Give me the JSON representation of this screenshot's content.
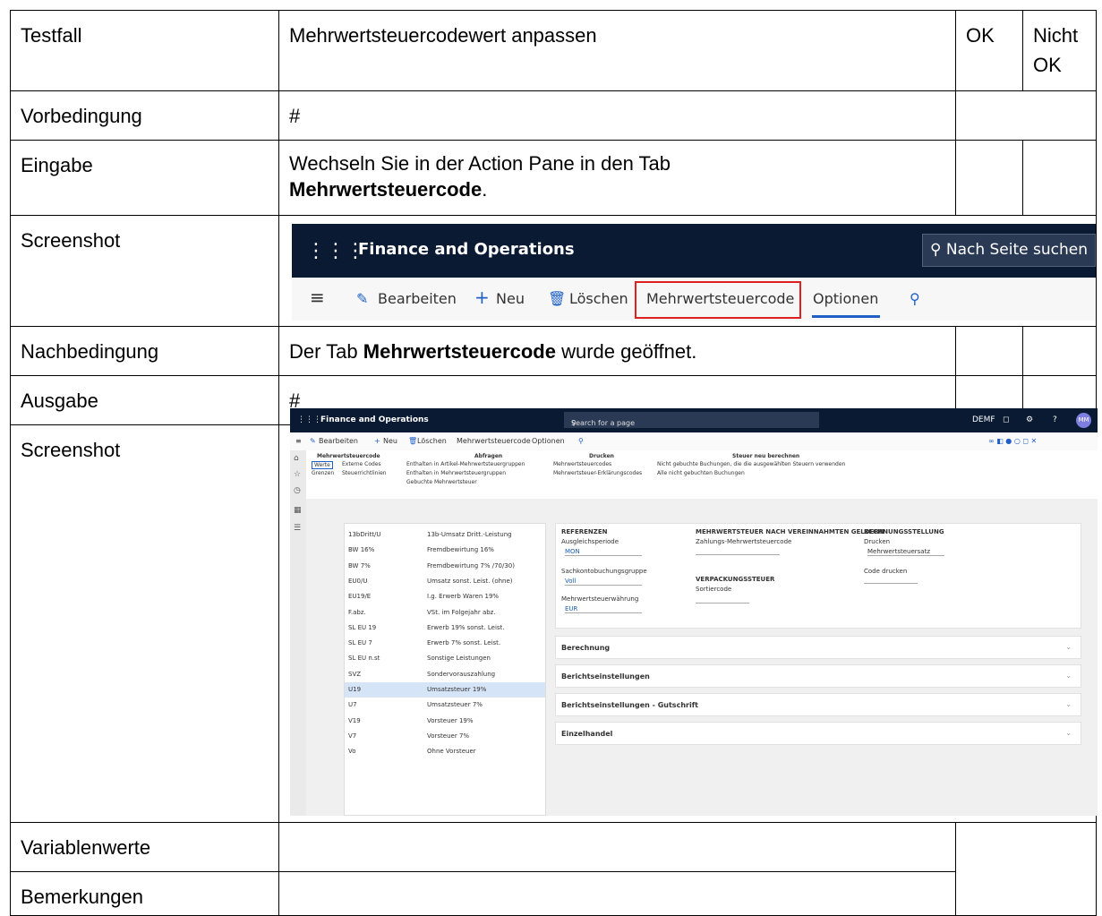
{
  "table": {
    "testfall_label": "Testfall",
    "testfall_value": "Mehrwertsteuercodewert anpassen",
    "ok_label": "OK",
    "nicht_ok_label": "Nicht OK",
    "vorbedingung_label": "Vorbedingung",
    "vorbedingung_value": "#",
    "eingabe_label": "Eingabe",
    "eingabe_text_1": "Wechseln Sie in der Action Pane in den Tab",
    "eingabe_text_bold": "Mehrwertsteuercode",
    "eingabe_text_end": ".",
    "screenshot_label": "Screenshot",
    "nachbedingung_label": "Nachbedingung",
    "nachbedingung_text_1": "Der Tab",
    "nachbedingung_text_bold": "Mehrwertsteuercode",
    "nachbedingung_text_2": "wurde geöffnet.",
    "ausgabe_label": "Ausgabe",
    "ausgabe_value": "#",
    "variablenwerte_label": "Variablenwerte",
    "bemerkungen_label": "Bemerkungen"
  },
  "shot1": {
    "app_title": "Finance and Operations",
    "search_label": "Nach Seite suchen",
    "actions": {
      "edit": "Bearbeiten",
      "new": "Neu",
      "delete": "Löschen",
      "vat_code": "Mehrwertsteuercode",
      "options": "Optionen"
    },
    "highlight_color": "#e02020"
  },
  "shot2": {
    "app_title": "Finance and Operations",
    "search_placeholder": "Search for a page",
    "company": "DEMF",
    "avatar": "MM",
    "actions": {
      "edit": "Bearbeiten",
      "new": "Neu",
      "delete": "Löschen",
      "vat_code": "Mehrwertsteuercode",
      "options": "Optionen"
    },
    "ribbon": {
      "group1_title": "Mehrwertsteuercode",
      "werte": "Werte",
      "externe_codes": "Externe Codes",
      "grenzen": "Grenzen",
      "steuerrichtlinien": "Steuerrichtlinien",
      "group2_title": "Abfragen",
      "enthalten_artikel": "Enthalten in Artikel-Mehrwertsteuergruppen",
      "enthalten_mwst": "Enthalten in Mehrwertsteuergruppen",
      "gebuchte": "Gebuchte Mehrwertsteuer",
      "group3_title": "Drucken",
      "mwst_codes": "Mehrwertsteuercodes",
      "erklaerung": "Mehrwertsteuer-Erklärungscodes",
      "group4_title": "Steuer neu berechnen",
      "nicht_gebuchte": "Nicht gebuchte Buchungen, die die ausgewählten Steuern verwenden",
      "alle_nicht_gebuchte": "Alle nicht gebuchten Buchungen"
    },
    "list_rows": [
      {
        "code": "13bDritt/U",
        "name": "13b-Umsatz Dritt.-Leistung"
      },
      {
        "code": "BW 16%",
        "name": "Fremdbewirtung 16%"
      },
      {
        "code": "BW 7%",
        "name": "Fremdbewirtung 7% /70/30)"
      },
      {
        "code": "EU0/U",
        "name": "Umsatz sonst. Leist. (ohne)"
      },
      {
        "code": "EU19/E",
        "name": "I.g. Erwerb Waren 19%"
      },
      {
        "code": "F.abz.",
        "name": "VSt. im Folgejahr abz."
      },
      {
        "code": "SL EU 19",
        "name": "Erwerb 19% sonst. Leist."
      },
      {
        "code": "SL EU 7",
        "name": "Erwerb 7% sonst. Leist."
      },
      {
        "code": "SL EU n.st",
        "name": "Sonstige Leistungen"
      },
      {
        "code": "SVZ",
        "name": "Sondervorauszahlung"
      },
      {
        "code": "U19",
        "name": "Umsatzsteuer 19%"
      },
      {
        "code": "U7",
        "name": "Umsatzsteuer 7%"
      },
      {
        "code": "V19",
        "name": "Vorsteuer 19%"
      },
      {
        "code": "V7",
        "name": "Vorsteuer 7%"
      },
      {
        "code": "Vo",
        "name": "Ohne Vorsteuer"
      }
    ],
    "detail": {
      "referenzen": "REFERENZEN",
      "ausgleichsperiode_label": "Ausgleichsperiode",
      "ausgleichsperiode_value": "MON",
      "sachkonto_label": "Sachkontobuchungsgruppe",
      "sachkonto_value": "Voll",
      "waehrung_label": "Mehrwertsteuerwährung",
      "waehrung_value": "EUR",
      "mwst_vereinnahmt": "MEHRWERTSTEUER NACH VEREINNAHMTEN GELDERN",
      "zahlungs_label": "Zahlungs-Mehrwertsteuercode",
      "verpackung": "VERPACKUNGSSTEUER",
      "sortiercode_label": "Sortiercode",
      "rechnungsstellung": "RECHNUNGSSTELLUNG",
      "drucken_label": "Drucken",
      "drucken_value": "Mehrwertsteuersatz",
      "code_drucken_label": "Code drucken",
      "berechnung": "Berechnung",
      "berichtseinstellungen": "Berichtseinstellungen",
      "berichtseinstellungen_gutschrift": "Berichtseinstellungen - Gutschrift",
      "einzelhandel": "Einzelhandel"
    }
  }
}
